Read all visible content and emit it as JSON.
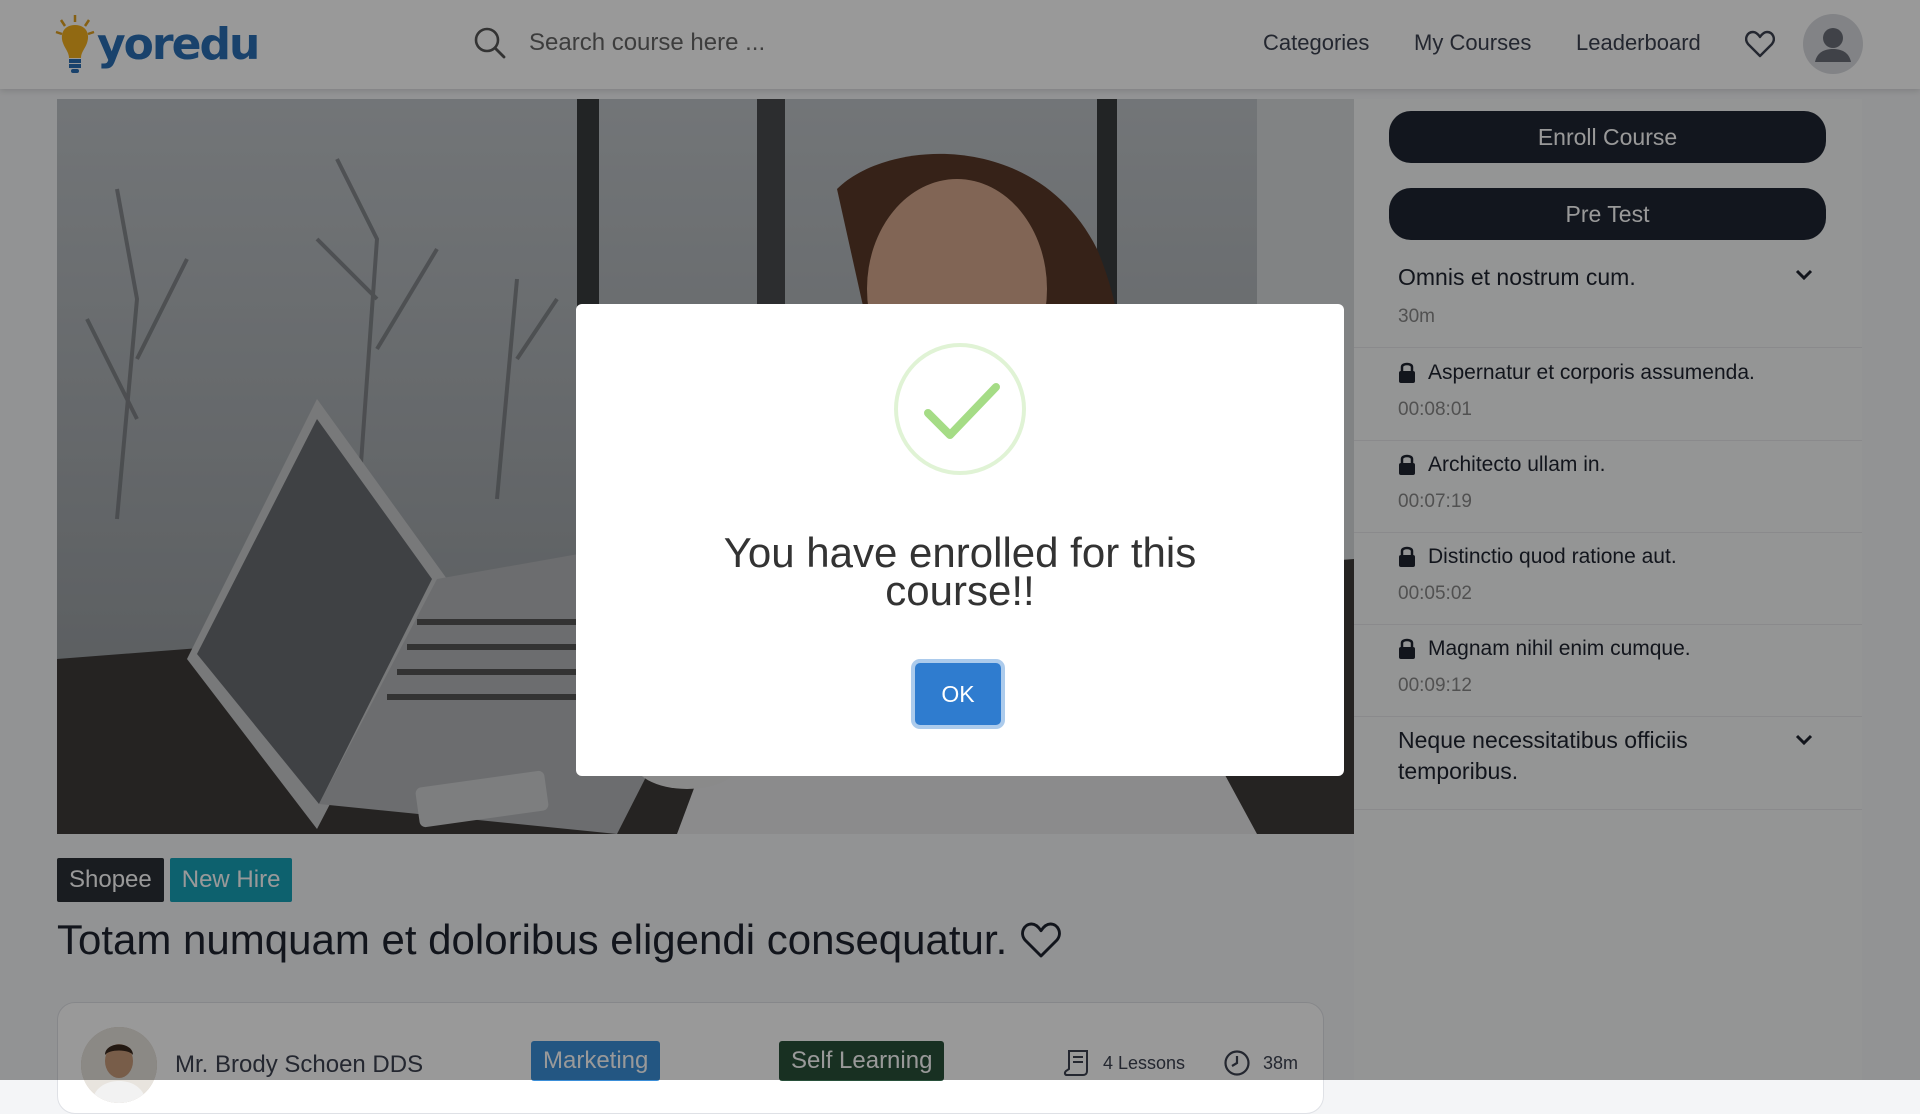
{
  "header": {
    "logo_text": "yoredu",
    "search_placeholder": "Search course here ...",
    "nav": [
      "Categories",
      "My Courses",
      "Leaderboard"
    ]
  },
  "course": {
    "tags": [
      "Shopee",
      "New Hire"
    ],
    "title": "Totam numquam et doloribus eligendi consequatur.",
    "instructor": "Mr. Brody Schoen DDS",
    "category": "Marketing",
    "type": "Self Learning",
    "lessons": "4 Lessons",
    "duration": "38m"
  },
  "sidebar": {
    "enroll_label": "Enroll Course",
    "pretest_label": "Pre Test",
    "sections": [
      {
        "title": "Omnis et nostrum cum.",
        "duration": "30m",
        "lessons": [
          {
            "title": "Aspernatur et corporis assumenda.",
            "time": "00:08:01"
          },
          {
            "title": "Architecto ullam in.",
            "time": "00:07:19"
          },
          {
            "title": "Distinctio quod ratione aut.",
            "time": "00:05:02"
          },
          {
            "title": "Magnam nihil enim cumque.",
            "time": "00:09:12"
          }
        ]
      },
      {
        "title_line1": "Neque necessitatibus officiis",
        "title_line2": "temporibus."
      }
    ]
  },
  "modal": {
    "title_line1": "You have enrolled for this",
    "title_line2": "course!!",
    "ok_label": "OK"
  },
  "colors": {
    "brand": "#2a6fb5",
    "dark_button": "#1e2532",
    "tag_teal": "#17a2b8",
    "marketing_badge": "#3b8fd9",
    "self_learning_badge": "#28503a",
    "ok_button": "#2f7ccf",
    "success": "#a5dc86"
  }
}
